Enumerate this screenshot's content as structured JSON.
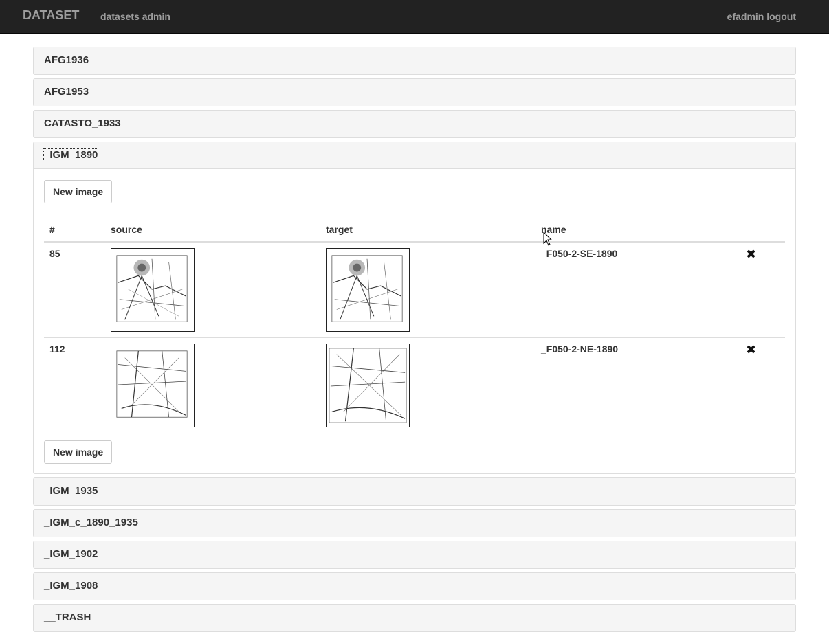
{
  "navbar": {
    "brand": "DATASET",
    "admin_link": "datasets admin",
    "user_link": "efadmin logout"
  },
  "datasets": [
    {
      "title": "AFG1936"
    },
    {
      "title": "AFG1953"
    },
    {
      "title": "CATASTO_1933"
    },
    {
      "title": "_IGM_1890"
    },
    {
      "title": "_IGM_1935"
    },
    {
      "title": "_IGM_c_1890_1935"
    },
    {
      "title": "_IGM_1902"
    },
    {
      "title": "_IGM_1908"
    },
    {
      "title": "__TRASH"
    }
  ],
  "open_panel": {
    "new_image_label": "New image",
    "columns": [
      "#",
      "source",
      "target",
      "name"
    ],
    "rows": [
      {
        "id": "85",
        "name": "_F050-2-SE-1890",
        "remove_icon": "remove-icon"
      },
      {
        "id": "112",
        "name": "_F050-2-NE-1890",
        "remove_icon": "remove-icon"
      }
    ]
  },
  "colors": {
    "navbar_bg": "#222222",
    "navbar_text": "#9d9d9d",
    "panel_heading_bg": "#f5f5f5",
    "border": "#dddddd"
  }
}
